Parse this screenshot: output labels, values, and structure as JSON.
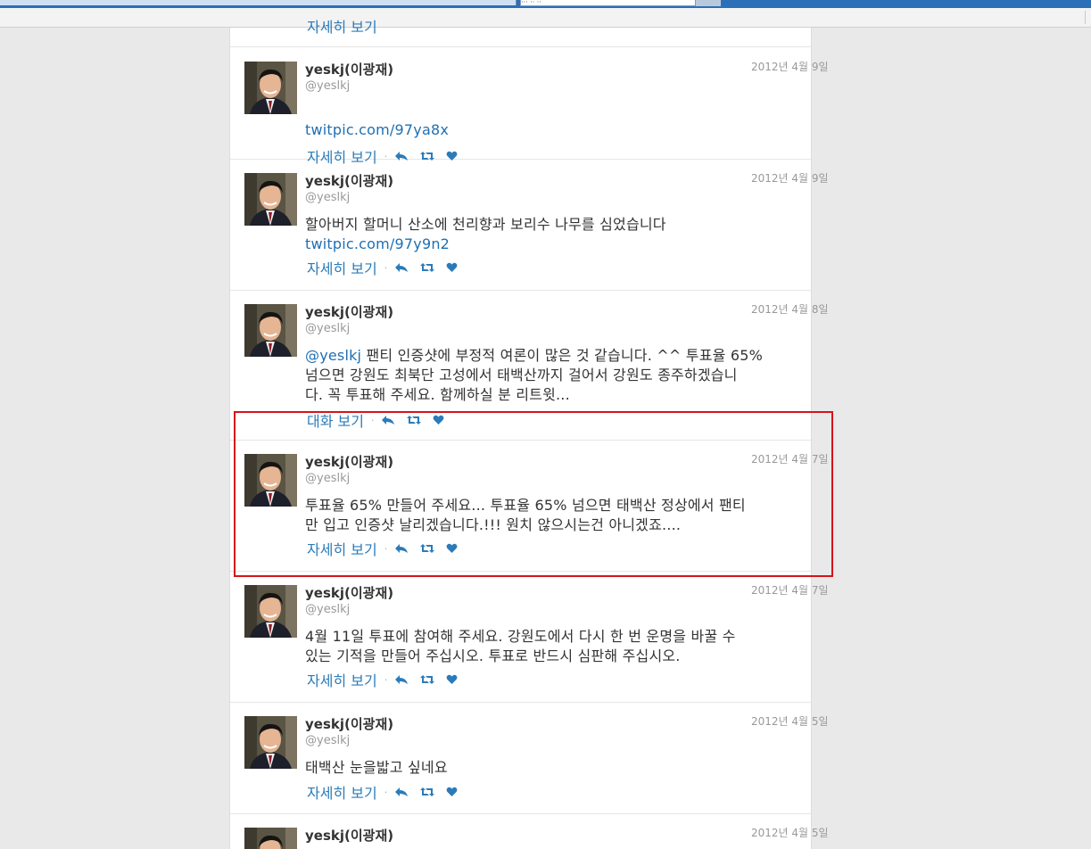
{
  "colors": {
    "link": "#1f6fb2",
    "action": "#2b7bb9",
    "highlight_box": "#d4141a",
    "name": "#333333",
    "muted": "#999999"
  },
  "browser": {
    "tab_text": "··· ·· ··"
  },
  "partial_top": {
    "action_label": "자세히 보기"
  },
  "tweets": [
    {
      "name": "yeskj(이광재)",
      "handle": "@yeslkj",
      "date": "2012년 4월 9일",
      "line1": "",
      "line1_link": "twitpic.com/97ya8x",
      "line2": "",
      "line2_link": "",
      "line3": "",
      "action_label": "자세히 보기"
    },
    {
      "name": "yeskj(이광재)",
      "handle": "@yeslkj",
      "date": "2012년 4월 9일",
      "line1": "할아버지 할머니 산소에 천리향과 보리수 나무를 심었습니다",
      "line2_link": "twitpic.com/97y9n2",
      "action_label": "자세히 보기"
    },
    {
      "name": "yeskj(이광재)",
      "handle": "@yeslkj",
      "date": "2012년 4월 8일",
      "mention": "@yeslkj",
      "line1": " 팬티 인증샷에 부정적 여론이 많은 것 같습니다. ^^ 투표율 65%",
      "line2": "넘으면 강원도 최북단 고성에서 태백산까지 걸어서 강원도 종주하겠습니",
      "line3": "다. 꼭 투표해 주세요. 함께하실 분 리트윗...",
      "action_label": "대화 보기"
    },
    {
      "name": "yeskj(이광재)",
      "handle": "@yeslkj",
      "date": "2012년 4월 7일",
      "line1": "투표율 65% 만들어 주세요... 투표율 65% 넘으면 태백산 정상에서 팬티",
      "line2": "만 입고 인증샷 날리겠습니다.!!! 원치 않으시는건 아니겠죠....",
      "action_label": "자세히 보기"
    },
    {
      "name": "yeskj(이광재)",
      "handle": "@yeslkj",
      "date": "2012년 4월 7일",
      "line1": "4월 11일 투표에 참여해 주세요. 강원도에서 다시 한 번 운명을 바꿀 수",
      "line2": "있는 기적을 만들어 주십시오. 투표로 반드시 심판해 주십시오.",
      "action_label": "자세히 보기"
    },
    {
      "name": "yeskj(이광재)",
      "handle": "@yeslkj",
      "date": "2012년 4월 5일",
      "line1": "태백산 눈을밟고 싶네요",
      "action_label": "자세히 보기"
    },
    {
      "name": "yeskj(이광재)",
      "date": "2012년 4월 5일"
    }
  ],
  "icons": {
    "reply": "reply-icon",
    "retweet": "retweet-icon",
    "favorite": "heart-icon",
    "avatar": "profile-photo"
  }
}
